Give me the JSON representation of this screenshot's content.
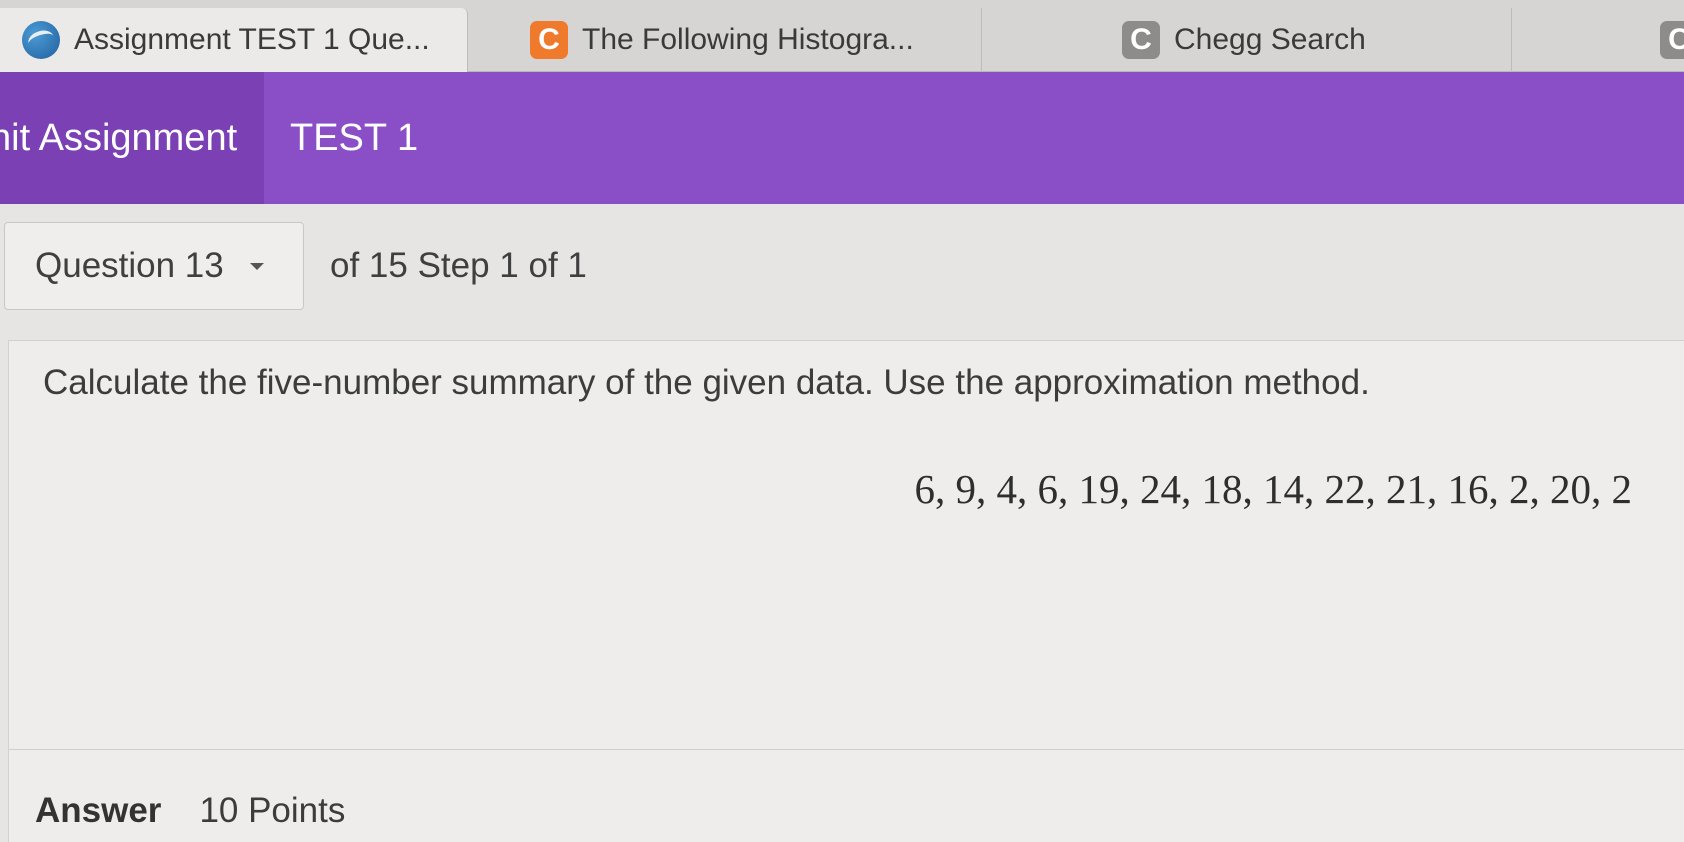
{
  "browser": {
    "tabs": [
      {
        "icon": "globe-icon",
        "title": "Assignment TEST 1 Que..."
      },
      {
        "icon": "chegg-c-icon",
        "icon_letter": "C",
        "title": "The Following Histogra..."
      },
      {
        "icon": "chegg-c-icon",
        "icon_letter": "C",
        "title": "Chegg Search"
      },
      {
        "icon": "chegg-c-icon",
        "icon_letter": "C",
        "title": ""
      }
    ]
  },
  "header": {
    "section": "nit Assignment",
    "title": "TEST 1",
    "colors": {
      "bar": "#8a4fc7",
      "section": "#7a40b4"
    }
  },
  "question_nav": {
    "selected": "Question 13",
    "step_info": "of 15 Step 1 of 1"
  },
  "question": {
    "prompt": "Calculate the five-number summary of the given data. Use the approximation method.",
    "data": "6, 9, 4, 6, 19, 24, 18, 14, 22, 21, 16, 2, 20, 2"
  },
  "answer": {
    "label": "Answer",
    "points": "10 Points"
  }
}
